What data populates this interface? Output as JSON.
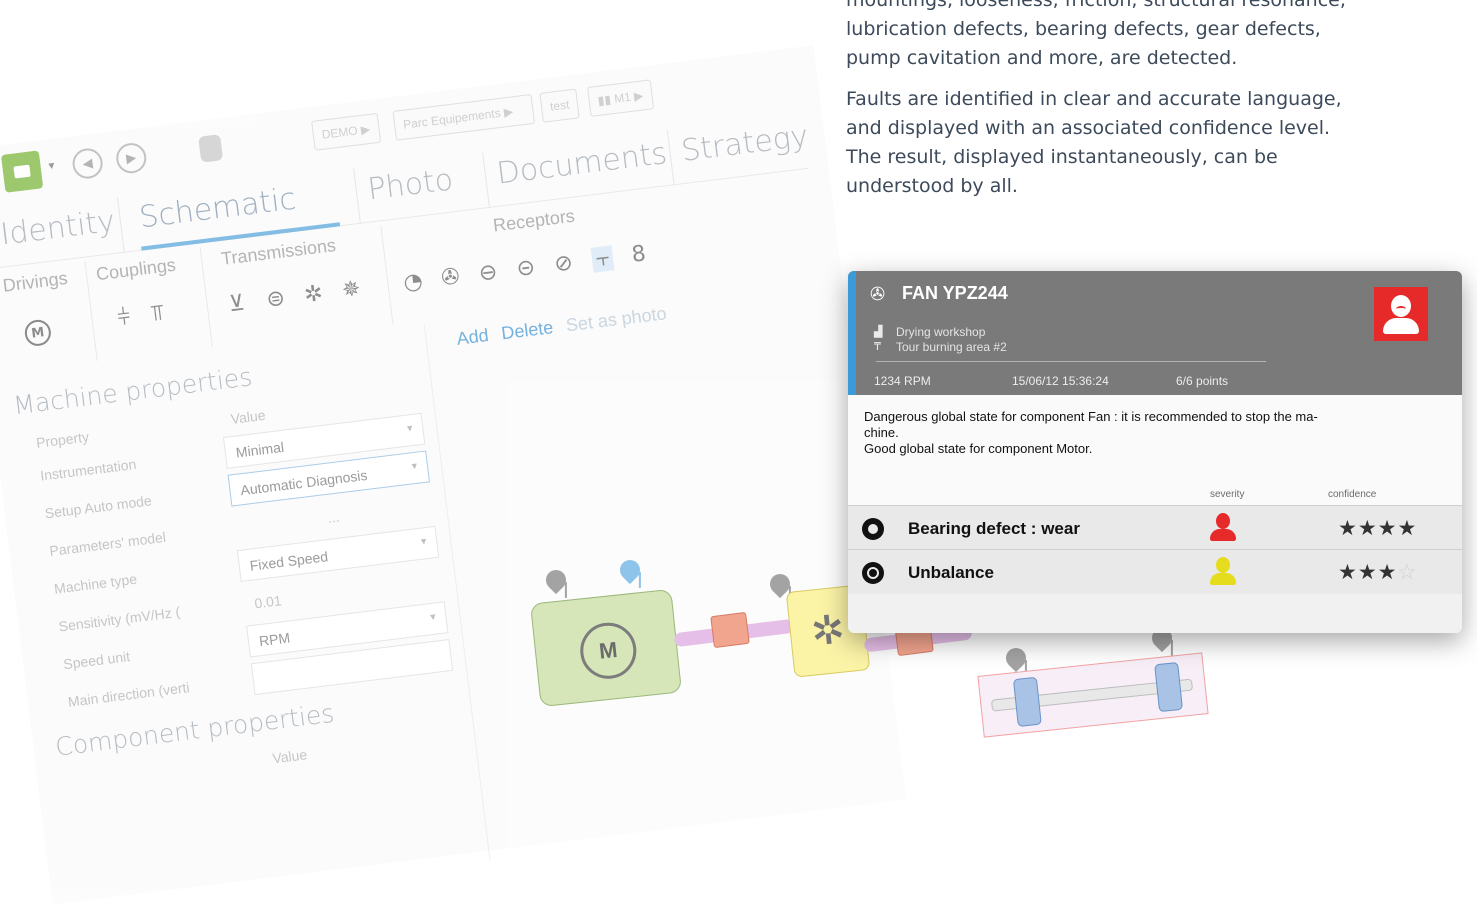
{
  "intro": {
    "para1": "mountings, looseness, friction, structural resonance, lubrication defects, bearing defects, gear defects, pump cavitation and more, are detected.",
    "para2": "Faults are identified in clear and accurate language, and displayed with an associated confidence level. The result, displayed instantaneously, can be understood by all."
  },
  "toolbar": {
    "crumbs": [
      "DEMO",
      "Parc Equipements",
      "test",
      "M1"
    ]
  },
  "tabs": [
    "Identity",
    "Schematic",
    "Photo",
    "Documents",
    "Strategy"
  ],
  "active_tab": "Schematic",
  "groups": {
    "drivings": "Drivings",
    "couplings": "Couplings",
    "transmissions": "Transmissions",
    "receptors": "Receptors",
    "motor_symbol": "M"
  },
  "actions": {
    "add": "Add",
    "delete": "Delete",
    "set_as_photo": "Set as photo"
  },
  "machine_properties": {
    "title": "Machine properties",
    "col_property": "Property",
    "col_value": "Value",
    "rows": [
      {
        "label": "Instrumentation",
        "value": "Minimal"
      },
      {
        "label": "Setup Auto mode",
        "value": "Automatic Diagnosis"
      },
      {
        "label": "Parameters' model",
        "value": "..."
      },
      {
        "label": "Machine type",
        "value": "Fixed Speed"
      },
      {
        "label": "Sensitivity (mV/Hz (",
        "value": "0.01"
      },
      {
        "label": "Speed unit",
        "value": "RPM"
      },
      {
        "label": "Main direction (verti",
        "value": ""
      }
    ]
  },
  "component_properties": {
    "title": "Component properties",
    "col_value": "Value"
  },
  "schematic": {
    "motor_label": "M"
  },
  "card": {
    "title": "FAN YPZ244",
    "location1": "Drying workshop",
    "location2": "Tour burning area #2",
    "rpm": "1234 RPM",
    "datetime": "15/06/12 15:36:24",
    "points": "6/6 points",
    "message_line1": "Dangerous global state for component Fan : it is recommended to stop the ma-",
    "message_line2": "chine.",
    "message_line3": "Good global state for component Motor.",
    "col_severity": "severity",
    "col_confidence": "confidence",
    "status_color": "#e62929",
    "faults": [
      {
        "name": "Bearing defect : wear",
        "severity_color": "#e62929",
        "confidence": 4,
        "confidence_max": 4
      },
      {
        "name": "Unbalance",
        "severity_color": "#e6dc1e",
        "confidence": 3,
        "confidence_max": 4
      }
    ]
  }
}
